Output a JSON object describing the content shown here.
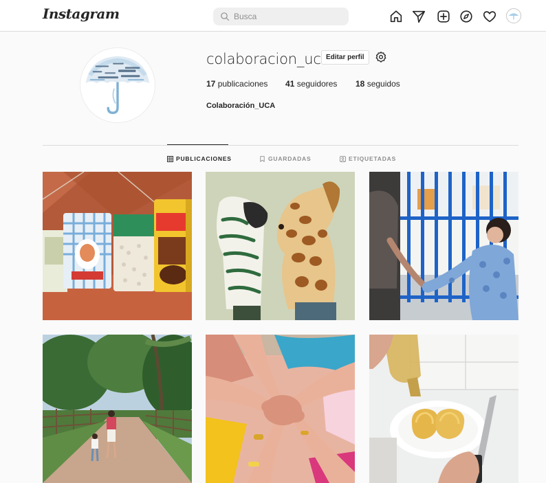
{
  "nav": {
    "logo": "Instagram",
    "search_placeholder": "Busca",
    "icons": [
      "home-icon",
      "direct-icon",
      "new-post-icon",
      "explore-icon",
      "activity-icon",
      "profile-avatar"
    ]
  },
  "profile": {
    "username": "colaboracion_uca",
    "edit_label": "Editar perfil",
    "stats": {
      "posts_count": "17",
      "posts_label": "publicaciones",
      "followers_count": "41",
      "followers_label": "seguidores",
      "following_count": "18",
      "following_label": "seguidos"
    },
    "full_name": "Colaboración_UCA"
  },
  "tabs": [
    {
      "label": "PUBLICACIONES",
      "active": true,
      "icon": "grid-icon"
    },
    {
      "label": "GUARDADAS",
      "active": false,
      "icon": "bookmark-icon"
    },
    {
      "label": "ETIQUETADAS",
      "active": false,
      "icon": "tagged-icon"
    }
  ],
  "posts": [
    {
      "subject": "food-packages",
      "icon": "photo"
    },
    {
      "subject": "animal-puppets",
      "icon": "photo"
    },
    {
      "subject": "child-at-school-gate",
      "icon": "photo"
    },
    {
      "subject": "park-walk",
      "icon": "photo"
    },
    {
      "subject": "joined-hands",
      "icon": "photo"
    },
    {
      "subject": "toast-with-oil",
      "icon": "photo"
    }
  ],
  "colors": {
    "background": "#fafafa",
    "border": "#dbdbdb",
    "text": "#262626",
    "muted": "#8e8e8e"
  }
}
